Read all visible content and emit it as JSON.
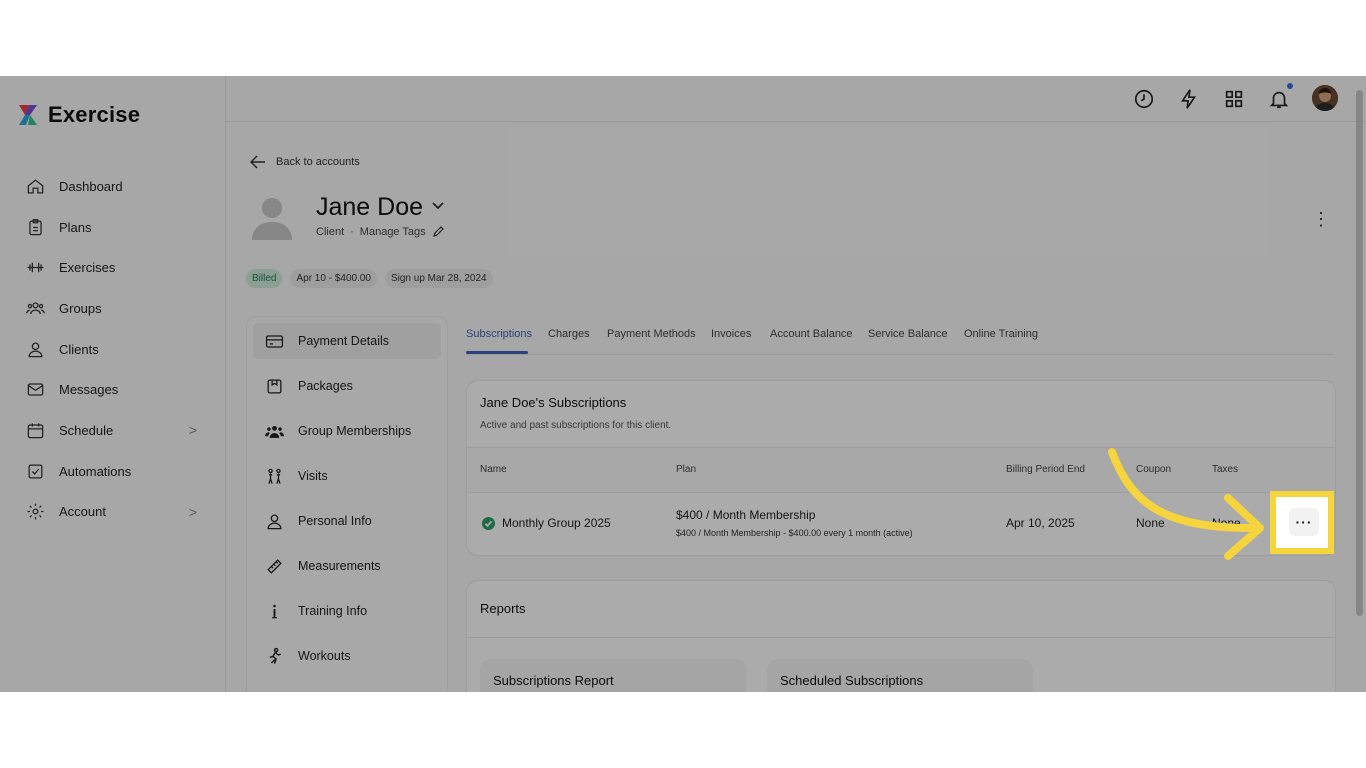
{
  "app": {
    "title": "Exercise"
  },
  "sidebar": {
    "items": [
      {
        "label": "Dashboard"
      },
      {
        "label": "Plans"
      },
      {
        "label": "Exercises"
      },
      {
        "label": "Groups"
      },
      {
        "label": "Clients"
      },
      {
        "label": "Messages"
      },
      {
        "label": "Schedule",
        "chevron": ">"
      },
      {
        "label": "Automations"
      },
      {
        "label": "Account",
        "chevron": ">"
      }
    ]
  },
  "topbar": {
    "icons": [
      "clock-icon",
      "bolt-icon",
      "apps-grid-icon",
      "bell-icon",
      "user-avatar"
    ]
  },
  "header": {
    "back_label": "Back to accounts",
    "client_name": "Jane Doe",
    "client_role": "Client",
    "separator": "·",
    "manage_tags": "Manage Tags",
    "more_icon": "⋮"
  },
  "chips": [
    "Billed",
    "Apr 10 - $400.00",
    "Sign up Mar 28, 2024"
  ],
  "subnav": {
    "items": [
      {
        "label": "Payment Details"
      },
      {
        "label": "Packages"
      },
      {
        "label": "Group Memberships"
      },
      {
        "label": "Visits"
      },
      {
        "label": "Personal Info"
      },
      {
        "label": "Measurements"
      },
      {
        "label": "Training Info"
      },
      {
        "label": "Workouts"
      }
    ]
  },
  "tabs": [
    "Subscriptions",
    "Charges",
    "Payment Methods",
    "Invoices",
    "Account Balance",
    "Service Balance",
    "Online Training"
  ],
  "subscriptions": {
    "title": "Jane Doe's Subscriptions",
    "subtitle": "Active and past subscriptions for this client.",
    "columns": [
      "Name",
      "Plan",
      "Billing Period End",
      "Coupon",
      "Taxes"
    ],
    "row": {
      "name": "Monthly Group 2025",
      "plan": "$400 / Month Membership",
      "plan_detail": "$400 / Month Membership - $400.00 every 1 month (active)",
      "billing_end": "Apr 10, 2025",
      "coupon": "None",
      "taxes": "None",
      "more": "···"
    }
  },
  "reports": {
    "title": "Reports",
    "cards": [
      "Subscriptions Report",
      "Scheduled Subscriptions"
    ]
  },
  "colors": {
    "accent": "#3e63b8",
    "highlight": "#f5d43d",
    "success": "#2f9e6a"
  }
}
